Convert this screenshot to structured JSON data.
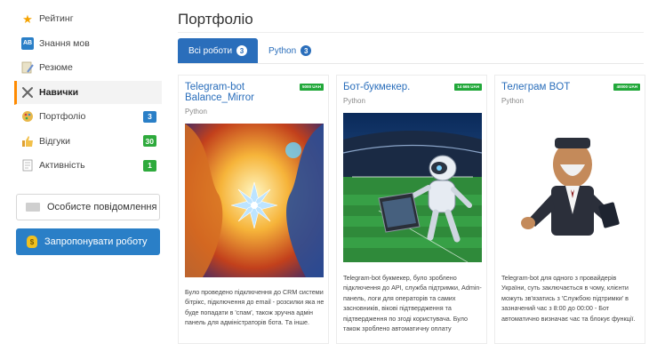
{
  "sidebar": {
    "items": [
      {
        "label": "Рейтинг",
        "icon": "star-icon"
      },
      {
        "label": "Знання мов",
        "icon": "language-icon"
      },
      {
        "label": "Резюме",
        "icon": "resume-icon"
      },
      {
        "label": "Навички",
        "icon": "tools-icon"
      },
      {
        "label": "Портфоліо",
        "icon": "portfolio-icon",
        "badge": "3"
      },
      {
        "label": "Відгуки",
        "icon": "thumbs-up-icon",
        "badge": "30"
      },
      {
        "label": "Активність",
        "icon": "activity-icon",
        "badge": "1"
      }
    ],
    "message_button": "Особисте повідомлення",
    "offer_button": "Запропонувати роботу"
  },
  "main": {
    "title": "Портфоліо",
    "tabs": [
      {
        "label": "Всі роботи",
        "count": "3"
      },
      {
        "label": "Python",
        "count": "3"
      }
    ],
    "cards": [
      {
        "title": "Telegram-bot Balance_Mirror",
        "price": "5000 UAH",
        "category": "Python",
        "description": "Було проведено підключення до CRM системи бітрікс, підключення до email - розсилки яка не буде попадати в 'спам', також зручна адмін панель для адміністраторів бота. Та інше."
      },
      {
        "title": "Бот-букмекер.",
        "price": "14 665 UAH",
        "category": "Python",
        "description": "Telegram-bot букмекер, було зроблено підключення до API, служба підтримки, Admin-панель, логи для операторів та самих засновників, вікові підтвердження та підтвердження по згоді користувача. Було також зроблено автоматичну оплату"
      },
      {
        "title": "Телеграм BOT",
        "price": "40000 UAH",
        "category": "Python",
        "description": "Telegram-bot для одного з провайдерів України, суть заключається в чому, клієнти можуть зв'язатись з 'Службою підтримки' в зазначений час з 8:00 до 00:00 - Бот автоматично визначає час та блокує функції."
      }
    ]
  },
  "colors": {
    "accent_blue": "#2a6ebb",
    "badge_blue": "#2a7fc7",
    "badge_green": "#2eaa3c",
    "price_green": "#22a83a",
    "active_marker": "#ff8a00"
  }
}
